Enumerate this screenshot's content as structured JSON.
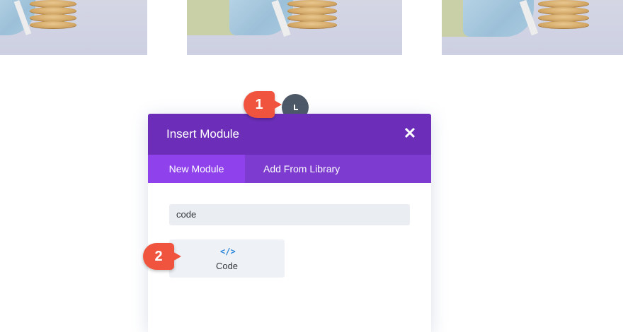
{
  "modal": {
    "title": "Insert Module",
    "close_icon": "close-icon",
    "tabs": [
      {
        "label": "New Module",
        "active": true
      },
      {
        "label": "Add From Library",
        "active": false
      }
    ],
    "search": {
      "value": "code"
    },
    "modules": [
      {
        "label": "Code",
        "icon": "code-icon"
      }
    ]
  },
  "badges": [
    "1",
    "2"
  ],
  "colors": {
    "header": "#6c2eb9",
    "tabs": "#7e3bd0",
    "tab_active": "#8f42ec",
    "badge": "#f0543f",
    "icon": "#2b87da"
  }
}
